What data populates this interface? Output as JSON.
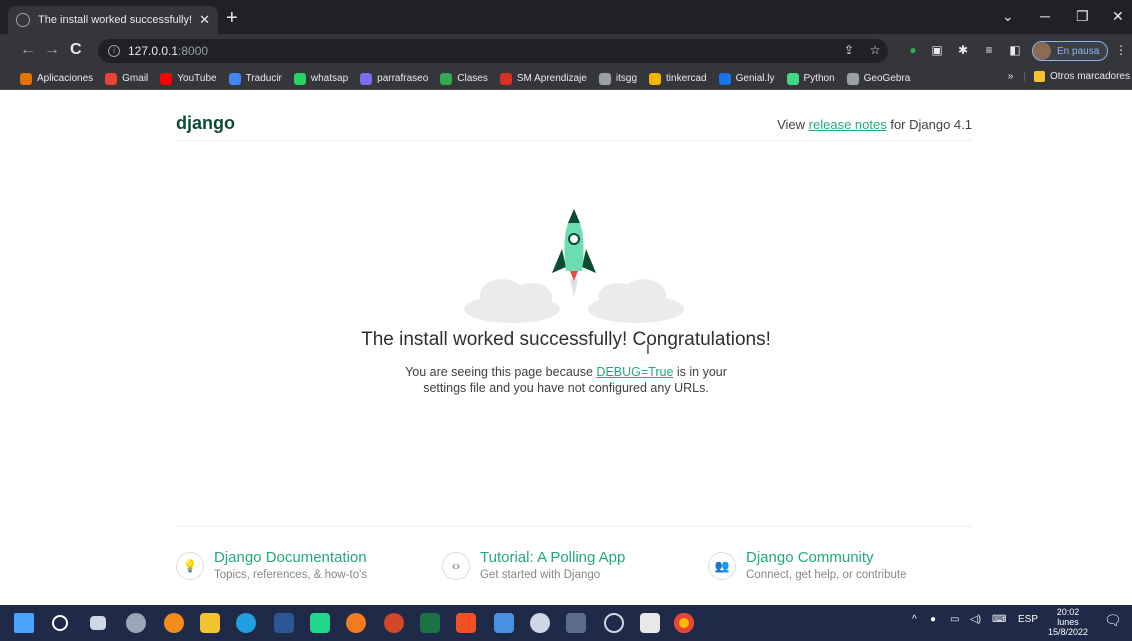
{
  "browser": {
    "tab_title": "The install worked successfully! C",
    "url_host": "127.0.0.1",
    "url_port": ":8000",
    "profile_label": "En pausa",
    "bookmarks": [
      {
        "label": "Aplicaciones",
        "color": "#e37400"
      },
      {
        "label": "Gmail",
        "color": "#ea4335"
      },
      {
        "label": "YouTube",
        "color": "#ff0000"
      },
      {
        "label": "Traducir",
        "color": "#4285f4"
      },
      {
        "label": "whatsap",
        "color": "#25d366"
      },
      {
        "label": "parrafraseo",
        "color": "#7c6cf0"
      },
      {
        "label": "Clases",
        "color": "#34a853"
      },
      {
        "label": "SM Aprendizaje",
        "color": "#d93025"
      },
      {
        "label": "itsgg",
        "color": "#9aa0a6"
      },
      {
        "label": "tinkercad",
        "color": "#f4b400"
      },
      {
        "label": "Genial.ly",
        "color": "#1a73e8"
      },
      {
        "label": "Python",
        "color": "#3ddc84"
      },
      {
        "label": "GeoGebra",
        "color": "#9aa0a6"
      }
    ],
    "bookmarks_more": "»",
    "other_bookmarks": "Otros marcadores"
  },
  "page": {
    "logo": "django",
    "release_prefix": "View ",
    "release_link": "release notes",
    "release_suffix": " for Django 4.1",
    "headline": "The install worked successfully! Congratulations!",
    "sub_prefix": "You are seeing this page because ",
    "sub_link": "DEBUG=True",
    "sub_mid": " is in your",
    "sub_line2": "settings file and you have not configured any URLs.",
    "cards": [
      {
        "title": "Django Documentation",
        "desc": "Topics, references, & how-to's"
      },
      {
        "title": "Tutorial: A Polling App",
        "desc": "Get started with Django"
      },
      {
        "title": "Django Community",
        "desc": "Connect, get help, or contribute"
      }
    ],
    "colors": {
      "brand": "#0c4b33",
      "accent": "#20aa76",
      "rocket": "#6dddb1"
    }
  },
  "taskbar": {
    "lang": "ESP",
    "time": "20:02",
    "day": "lunes",
    "date": "15/8/2022"
  }
}
